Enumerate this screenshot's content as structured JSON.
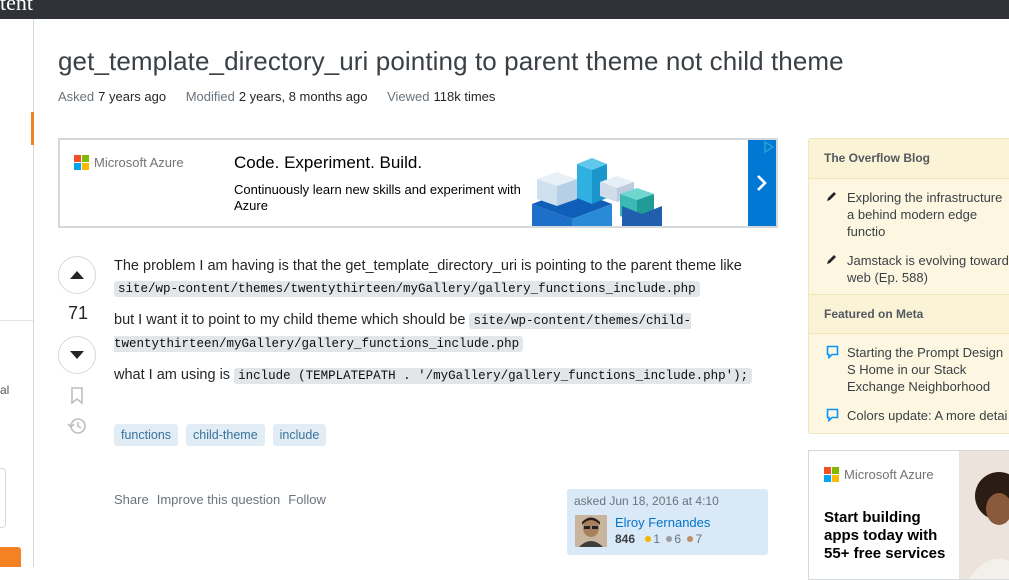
{
  "topbar": {
    "fragment": "tent"
  },
  "leftnav": {
    "fragment_text": "al"
  },
  "question": {
    "title": "get_template_directory_uri pointing to parent theme not child theme",
    "meta": [
      {
        "label": "Asked",
        "value": "7 years ago"
      },
      {
        "label": "Modified",
        "value": "2 years, 8 months ago"
      },
      {
        "label": "Viewed",
        "value": "118k times"
      }
    ],
    "votes": "71",
    "body": {
      "p1_text": "The problem I am having is that the get_template_directory_uri is pointing to the parent theme like",
      "p1_code": "site/wp-content/themes/twentythirteen/myGallery/gallery_functions_include.php",
      "p2_text": "but I want it to point to my child theme which should be",
      "p2_code": "site/wp-content/themes/child-twentythirteen/myGallery/gallery_functions_include.php",
      "p3_text": "what I am using is",
      "p3_code": "include (TEMPLATEPATH . '/myGallery/gallery_functions_include.php');"
    },
    "tags": [
      "functions",
      "child-theme",
      "include"
    ],
    "actions": {
      "share": "Share",
      "improve": "Improve this question",
      "follow": "Follow"
    },
    "owner": {
      "asked": "asked Jun 18, 2016 at 4:10",
      "name": "Elroy Fernandes",
      "reputation": "846",
      "gold": "1",
      "silver": "6",
      "bronze": "7"
    }
  },
  "ad_banner": {
    "brand": "Microsoft Azure",
    "headline": "Code. Experiment. Build.",
    "sub": "Continuously learn new skills and experiment with Azure",
    "arrow": "›"
  },
  "sidebar": {
    "blog_heading": "The Overflow Blog",
    "blog_items": [
      "Exploring the infrastructure a behind modern edge functio",
      "Jamstack is evolving toward web (Ep. 588)"
    ],
    "meta_heading": "Featured on Meta",
    "meta_items": [
      "Starting the Prompt Design S Home in our Stack Exchange Neighborhood",
      "Colors update: A more detai"
    ]
  },
  "ad_side": {
    "brand": "Microsoft Azure",
    "promo": "Start building apps today with 55+ free services"
  },
  "colors": {
    "accent_orange": "#f48225",
    "link_blue": "#0074cc",
    "tag_bg": "#e1ecf4",
    "tag_text": "#39739d",
    "azure_blue": "#0078d4"
  }
}
